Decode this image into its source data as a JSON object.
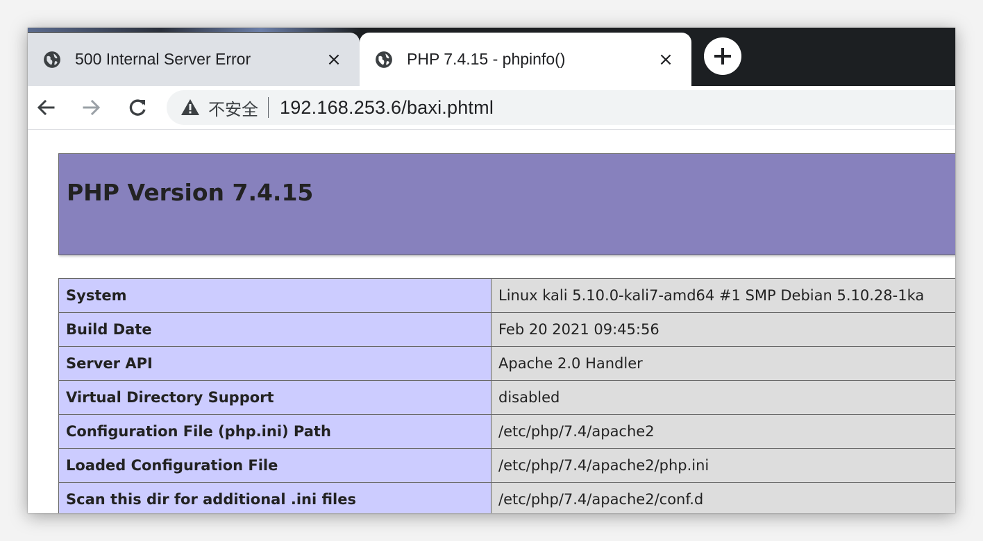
{
  "tabs": [
    {
      "title": "500 Internal Server Error",
      "close": "×",
      "active": false
    },
    {
      "title": "PHP 7.4.15 - phpinfo()",
      "close": "×",
      "active": true
    }
  ],
  "new_tab_icon": "plus-icon",
  "toolbar": {
    "back_icon": "arrow-left-icon",
    "forward_icon": "arrow-right-icon",
    "reload_icon": "reload-icon"
  },
  "omnibox": {
    "security_icon": "warning-triangle-icon",
    "security_label": "不安全",
    "url_host": "192.168.253.6",
    "url_path": "/baxi.phtml"
  },
  "page": {
    "heading": "PHP Version 7.4.15",
    "rows": [
      {
        "key": "System",
        "value": "Linux kali 5.10.0-kali7-amd64 #1 SMP Debian 5.10.28-1ka"
      },
      {
        "key": "Build Date",
        "value": "Feb 20 2021 09:45:56"
      },
      {
        "key": "Server API",
        "value": "Apache 2.0 Handler"
      },
      {
        "key": "Virtual Directory Support",
        "value": "disabled"
      },
      {
        "key": "Configuration File (php.ini) Path",
        "value": "/etc/php/7.4/apache2"
      },
      {
        "key": "Loaded Configuration File",
        "value": "/etc/php/7.4/apache2/php.ini"
      },
      {
        "key": "Scan this dir for additional .ini files",
        "value": "/etc/php/7.4/apache2/conf.d"
      }
    ]
  },
  "colors": {
    "header_bg": "#8781bd",
    "key_bg": "#ccccff",
    "value_bg": "#dddddd",
    "tabstrip_bg": "#1c1f22",
    "inactive_tab_bg": "#dee1e6"
  }
}
